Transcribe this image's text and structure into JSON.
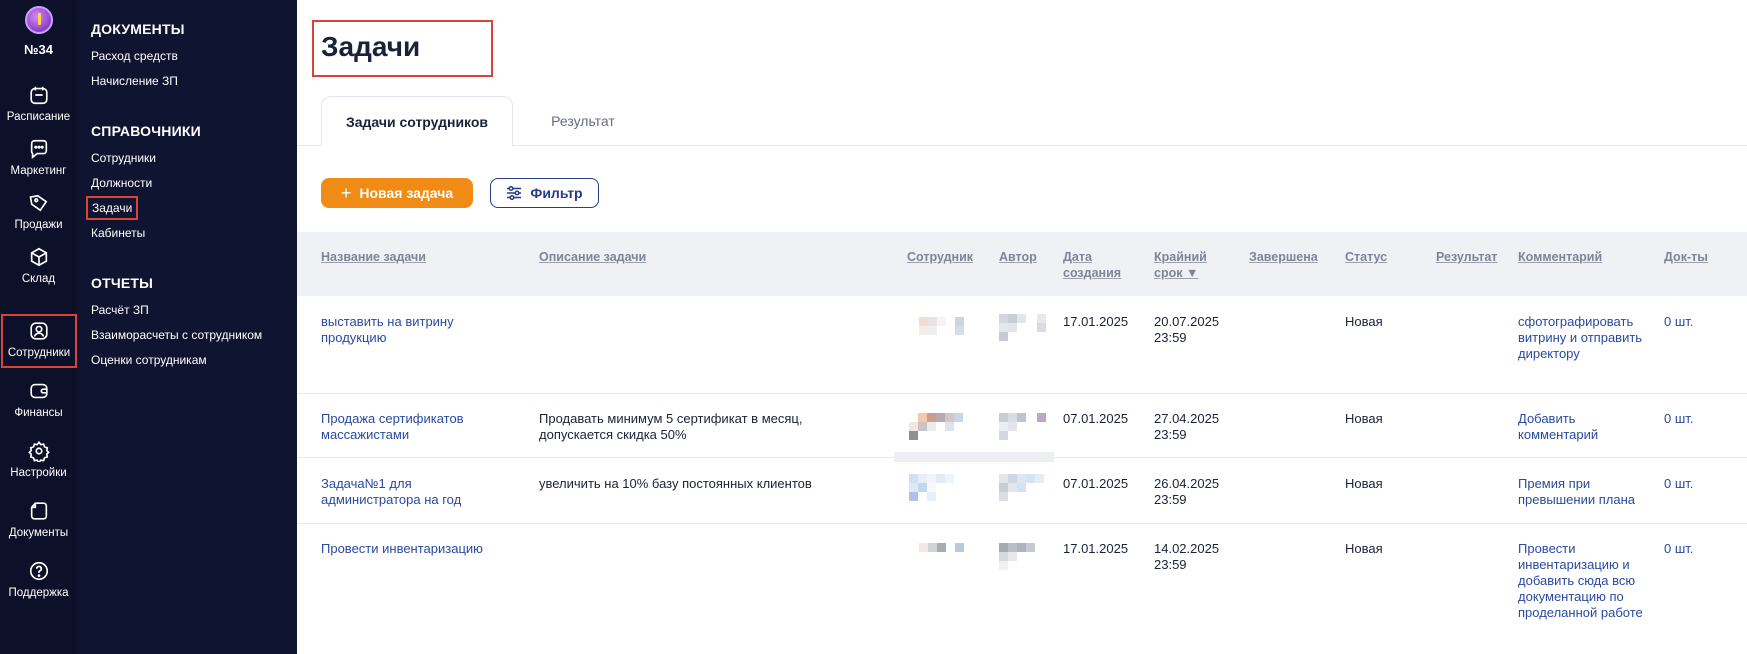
{
  "rail": {
    "badge": "№34",
    "items": [
      {
        "label": "Расписание",
        "icon": "calendar-icon"
      },
      {
        "label": "Маркетинг",
        "icon": "chat-icon"
      },
      {
        "label": "Продажи",
        "icon": "tag-icon"
      },
      {
        "label": "Склад",
        "icon": "box-icon"
      },
      {
        "label": "Сотрудники",
        "icon": "user-icon",
        "active": true
      },
      {
        "label": "Финансы",
        "icon": "wallet-icon"
      },
      {
        "label": "Настройки",
        "icon": "gear-icon"
      },
      {
        "label": "Документы",
        "icon": "document-icon"
      },
      {
        "label": "Поддержка",
        "icon": "help-icon"
      }
    ]
  },
  "nav": {
    "sections": [
      {
        "title": "ДОКУМЕНТЫ",
        "links": [
          "Расход средств",
          "Начисление ЗП"
        ]
      },
      {
        "title": "СПРАВОЧНИКИ",
        "links": [
          "Сотрудники",
          "Должности",
          "Задачи",
          "Кабинеты"
        ]
      },
      {
        "title": "ОТЧЕТЫ",
        "links": [
          "Расчёт ЗП",
          "Взаиморасчеты с сотрудником",
          "Оценки сотрудникам"
        ]
      }
    ],
    "active_link": "Задачи"
  },
  "page": {
    "title": "Задачи",
    "tabs": [
      "Задачи сотрудников",
      "Результат"
    ],
    "new_task_label": "Новая задача",
    "filter_label": "Фильтр"
  },
  "table": {
    "columns": [
      "Название задачи",
      "Описание задачи",
      "Сотрудник",
      "Автор",
      "Дата создания",
      "Крайний срок ▼",
      "Завершена",
      "Статус",
      "Результат",
      "Комментарий",
      "Док-ты"
    ],
    "rows": [
      {
        "name": "выставить на витрину продукцию",
        "description": "",
        "created": "17.01.2025",
        "deadline": "20.07.2025 23:59",
        "status": "Новая",
        "comment": "сфотографировать витрину и отправить директору",
        "docs": "0 шт."
      },
      {
        "name": "Продажа сертификатов массажистами",
        "description": "Продавать минимум 5 сертификат в месяц, допускается скидка 50%",
        "created": "07.01.2025",
        "deadline": "27.04.2025 23:59",
        "status": "Новая",
        "comment": "Добавить комментарий",
        "docs": "0 шт."
      },
      {
        "name": "Задача№1 для администратора на год",
        "description": "увеличить на 10% базу постоянных клиентов",
        "created": "07.01.2025",
        "deadline": "26.04.2025 23:59",
        "status": "Новая",
        "comment": "Премия при превышении плана",
        "docs": "0 шт."
      },
      {
        "name": "Провести инвентаризацию",
        "description": "",
        "created": "17.01.2025",
        "deadline": "14.02.2025 23:59",
        "status": "Новая",
        "comment": "Провести инвентаризацию и добавить сюда всю документацию по проделанной работе",
        "docs": "0 шт."
      }
    ]
  },
  "colors": {
    "rail_bg": "#0d1029",
    "nav_bg": "#0f1530",
    "accent_orange": "#f08c16",
    "link_blue": "#2a4aa0",
    "highlight_red": "#d9443a"
  }
}
